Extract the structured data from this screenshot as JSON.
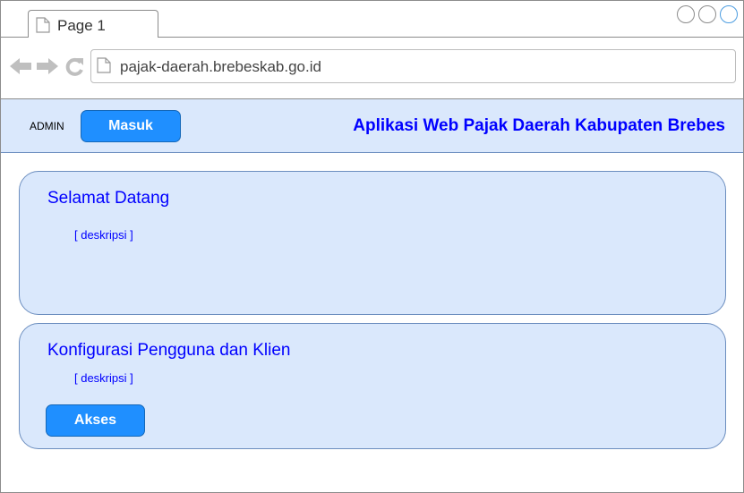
{
  "browser": {
    "tab_label": "Page 1",
    "url": "pajak-daerah.brebeskab.go.id"
  },
  "header": {
    "admin_label": "ADMIN",
    "login_button": "Masuk",
    "app_title": "Aplikasi Web Pajak Daerah Kabupaten Brebes"
  },
  "welcome_card": {
    "title": "Selamat Datang",
    "description": "[ deskripsi ]"
  },
  "config_card": {
    "title": "Konfigurasi Pengguna dan Klien",
    "description": "[ deskripsi ]",
    "button": "Akses"
  },
  "colors": {
    "accent_button": "#1f8fff",
    "panel_fill": "#dae8fc",
    "panel_border": "#6c8ebf",
    "title_text": "#0000ff"
  },
  "icons": [
    "document-icon",
    "back-arrow-icon",
    "forward-arrow-icon",
    "reload-icon",
    "window-control-icon"
  ]
}
